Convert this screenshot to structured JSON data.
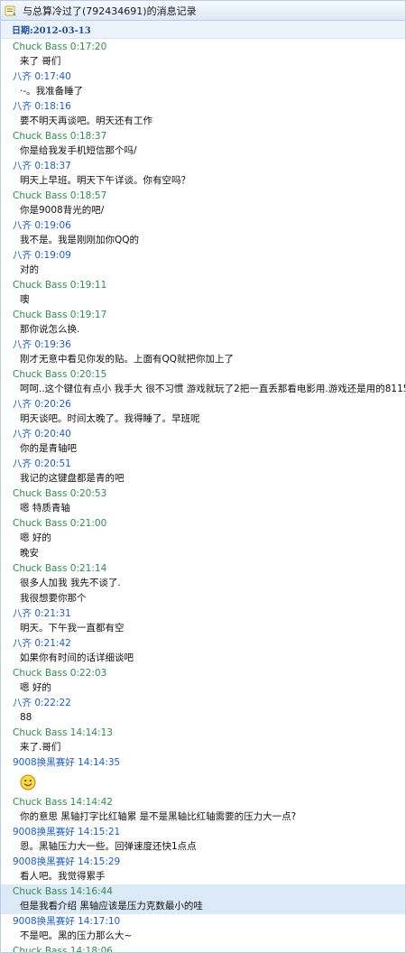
{
  "window": {
    "title": "与总算冷过了(792434691)的消息记录",
    "icon": "chat-history-icon"
  },
  "date_header": "日期:2012-03-13",
  "colors": {
    "chuck_name": "#2f8c52",
    "other_name": "#1d5cc8",
    "date": "#1e4f9c",
    "highlight": "#dceaf7"
  },
  "messages": [
    {
      "sender": "Chuck Bass",
      "time": "0:17:20",
      "lines": [
        "来了 哥们"
      ],
      "side": "chuck"
    },
    {
      "sender": "八齐",
      "time": "0:17:40",
      "lines": [
        "·-。我准备睡了"
      ],
      "side": "other"
    },
    {
      "sender": "八齐",
      "time": "0:18:16",
      "lines": [
        "要不明天再谈吧。明天还有工作"
      ],
      "side": "other"
    },
    {
      "sender": "Chuck Bass",
      "time": "0:18:37",
      "lines": [
        "你是给我发手机短信那个吗/"
      ],
      "side": "chuck"
    },
    {
      "sender": "八齐",
      "time": "0:18:37",
      "lines": [
        "明天上早班。明天下午详谈。你有空吗？"
      ],
      "side": "other"
    },
    {
      "sender": "Chuck Bass",
      "time": "0:18:57",
      "lines": [
        "你是9008背光的吧/"
      ],
      "side": "chuck"
    },
    {
      "sender": "八齐",
      "time": "0:19:06",
      "lines": [
        "我不是。我是刚刚加你QQ的"
      ],
      "side": "other"
    },
    {
      "sender": "八齐",
      "time": "0:19:09",
      "lines": [
        "对的"
      ],
      "side": "other"
    },
    {
      "sender": "Chuck Bass",
      "time": "0:19:11",
      "lines": [
        "噢"
      ],
      "side": "chuck"
    },
    {
      "sender": "Chuck Bass",
      "time": "0:19:17",
      "lines": [
        "那你说怎么换."
      ],
      "side": "chuck"
    },
    {
      "sender": "八齐",
      "time": "0:19:36",
      "lines": [
        "刚才无意中看见你发的贴。上面有QQ就把你加上了"
      ],
      "side": "other"
    },
    {
      "sender": "Chuck Bass",
      "time": "0:20:15",
      "lines": [
        "呵呵..这个键位有点小 我手大 很不习惯 游戏就玩了2把一直丢那看电影用.游戏还是用的8115"
      ],
      "side": "chuck"
    },
    {
      "sender": "八齐",
      "time": "0:20:26",
      "lines": [
        "明天谈吧。时间太晚了。我得睡了。早班呢"
      ],
      "side": "other"
    },
    {
      "sender": "八齐",
      "time": "0:20:40",
      "lines": [
        "你的是青轴吧"
      ],
      "side": "other"
    },
    {
      "sender": "八齐",
      "time": "0:20:51",
      "lines": [
        "我记的这键盘都是青的吧"
      ],
      "side": "other"
    },
    {
      "sender": "Chuck Bass",
      "time": "0:20:53",
      "lines": [
        "嗯 特质青轴"
      ],
      "side": "chuck"
    },
    {
      "sender": "Chuck Bass",
      "time": "0:21:00",
      "lines": [
        "嗯 好的",
        "晚安"
      ],
      "side": "chuck"
    },
    {
      "sender": "Chuck Bass",
      "time": "0:21:14",
      "lines": [
        "很多人加我 我先不谈了.",
        "我很想要你那个"
      ],
      "side": "chuck"
    },
    {
      "sender": "八齐",
      "time": "0:21:31",
      "lines": [
        "明天。下午我一直都有空"
      ],
      "side": "other"
    },
    {
      "sender": "八齐",
      "time": "0:21:42",
      "lines": [
        "如果你有时间的话详细谈吧"
      ],
      "side": "other"
    },
    {
      "sender": "Chuck Bass",
      "time": "0:22:03",
      "lines": [
        "嗯 好的"
      ],
      "side": "chuck"
    },
    {
      "sender": "八齐",
      "time": "0:22:22",
      "lines": [
        "88"
      ],
      "side": "other"
    },
    {
      "sender": "Chuck Bass",
      "time": "14:14:13",
      "lines": [
        "来了.哥们"
      ],
      "side": "chuck"
    },
    {
      "sender": "9008换黑赛好",
      "time": "14:14:35",
      "lines": [],
      "emoji": "smiley-emoji-icon",
      "side": "other"
    },
    {
      "sender": "Chuck Bass",
      "time": "14:14:42",
      "lines": [
        "你的意思 黑轴打字比红轴累 是不是黑轴比红轴需要的压力大一点?"
      ],
      "side": "chuck"
    },
    {
      "sender": "9008换黑赛好",
      "time": "14:15:21",
      "lines": [
        "恩。黑轴压力大一些。回弹速度还快1点点"
      ],
      "side": "other"
    },
    {
      "sender": "9008换黑赛好",
      "time": "14:15:29",
      "lines": [
        "看人吧。我觉得累手"
      ],
      "side": "other"
    },
    {
      "sender": "Chuck Bass",
      "time": "14:16:44",
      "lines": [
        "但是我看介绍 黑轴应该是压力克数最小的哇"
      ],
      "side": "chuck",
      "highlight": true
    },
    {
      "sender": "9008换黑赛好",
      "time": "14:17:10",
      "lines": [
        "不是吧。黑的压力那么大~"
      ],
      "side": "other"
    },
    {
      "sender": "Chuck Bass",
      "time": "14:18:06",
      "lines": [],
      "side": "chuck"
    }
  ]
}
